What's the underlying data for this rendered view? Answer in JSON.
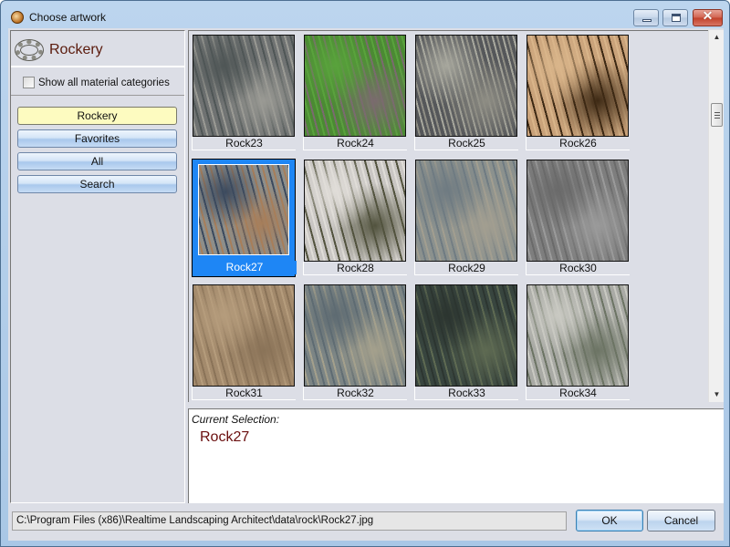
{
  "window": {
    "title": "Choose artwork",
    "controls": {
      "minimize": "minimize",
      "maximize": "maximize",
      "close": "✕"
    }
  },
  "sidebar": {
    "category_title": "Rockery",
    "show_all_label": "Show all material categories",
    "show_all_checked": false,
    "nav": [
      {
        "label": "Rockery",
        "active": true
      },
      {
        "label": "Favorites",
        "active": false
      },
      {
        "label": "All",
        "active": false
      },
      {
        "label": "Search",
        "active": false
      }
    ]
  },
  "grid": {
    "items": [
      {
        "label": "Rock23",
        "selected": false,
        "swatch": [
          "#6f7272",
          "#9a9a94",
          "#4f5656"
        ]
      },
      {
        "label": "Rock24",
        "selected": false,
        "swatch": [
          "#4b8a33",
          "#7a6b6e",
          "#59a23c"
        ]
      },
      {
        "label": "Rock25",
        "selected": false,
        "swatch": [
          "#55575a",
          "#8e8d84",
          "#a7a79d"
        ]
      },
      {
        "label": "Rock26",
        "selected": false,
        "swatch": [
          "#c9a27a",
          "#3d2914",
          "#d9b58a"
        ]
      },
      {
        "label": "Rock27",
        "selected": true,
        "swatch": [
          "#8d8e8a",
          "#a77e5a",
          "#3c4a5e"
        ]
      },
      {
        "label": "Rock28",
        "selected": false,
        "swatch": [
          "#c9c6c3",
          "#52533e",
          "#e0ddd8"
        ]
      },
      {
        "label": "Rock29",
        "selected": false,
        "swatch": [
          "#8b918e",
          "#a29e90",
          "#6f7b82"
        ]
      },
      {
        "label": "Rock30",
        "selected": false,
        "swatch": [
          "#7e7e7e",
          "#9a9a9a",
          "#6a6a6a"
        ]
      },
      {
        "label": "Rock31",
        "selected": false,
        "swatch": [
          "#a38a6c",
          "#8a7358",
          "#b59c7c"
        ]
      },
      {
        "label": "Rock32",
        "selected": false,
        "swatch": [
          "#7c8585",
          "#a4a08c",
          "#5e6b72"
        ]
      },
      {
        "label": "Rock33",
        "selected": false,
        "swatch": [
          "#38453f",
          "#5e6a52",
          "#2c3530"
        ]
      },
      {
        "label": "Rock34",
        "selected": false,
        "swatch": [
          "#a9aaa5",
          "#6c7464",
          "#c9c9c2"
        ]
      }
    ]
  },
  "selection": {
    "label": "Current Selection:",
    "value": "Rock27"
  },
  "footer": {
    "path": "C:\\Program Files (x86)\\Realtime Landscaping Architect\\data\\rock\\Rock27.jpg",
    "ok_label": "OK",
    "cancel_label": "Cancel"
  },
  "colors": {
    "selection_blue": "#1e86f5",
    "active_nav": "#fdfbc0",
    "category_title": "#5a1a0c"
  }
}
